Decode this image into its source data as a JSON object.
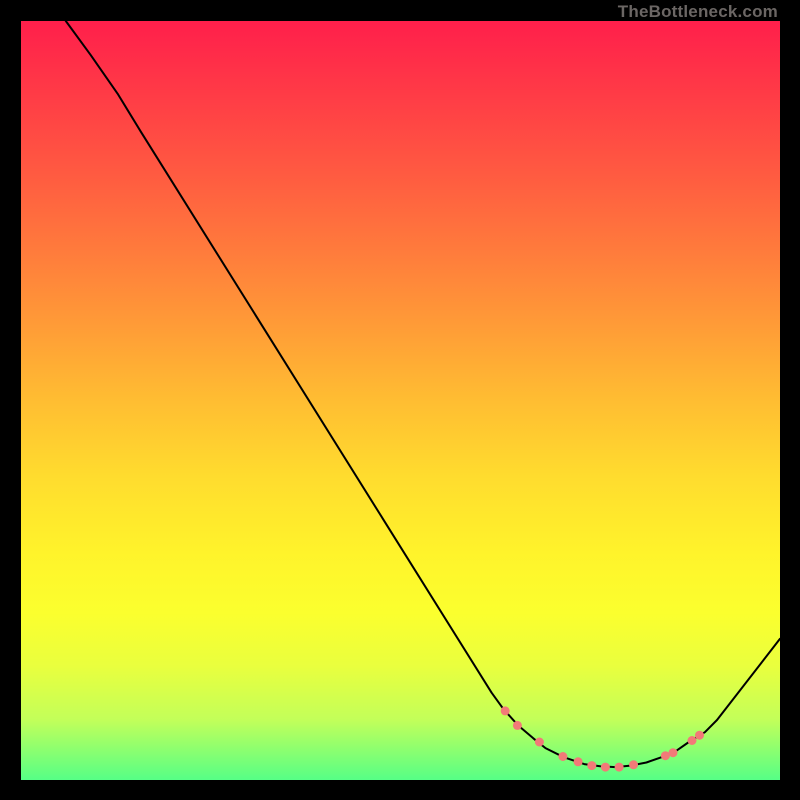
{
  "watermark": "TheBottleneck.com",
  "colors": {
    "background": "#000000",
    "curve_stroke": "#000000",
    "dot_fill": "#f27a78",
    "gradient_top": "#ff1f4b",
    "gradient_bottom": "#56ff86"
  },
  "chart_data": {
    "type": "line",
    "title": "",
    "xlabel": "",
    "ylabel": "",
    "xlim": [
      0,
      100
    ],
    "ylim": [
      0,
      100
    ],
    "curve": [
      {
        "x": 5.9,
        "y": 100.0
      },
      {
        "x": 9.2,
        "y": 95.5
      },
      {
        "x": 12.8,
        "y": 90.3
      },
      {
        "x": 15.8,
        "y": 85.4
      },
      {
        "x": 62.0,
        "y": 11.5
      },
      {
        "x": 63.6,
        "y": 9.3
      },
      {
        "x": 65.5,
        "y": 7.2
      },
      {
        "x": 67.5,
        "y": 5.5
      },
      {
        "x": 69.1,
        "y": 4.2
      },
      {
        "x": 71.5,
        "y": 3.0
      },
      {
        "x": 74.2,
        "y": 2.1
      },
      {
        "x": 76.3,
        "y": 1.8
      },
      {
        "x": 78.3,
        "y": 1.7
      },
      {
        "x": 80.3,
        "y": 1.9
      },
      {
        "x": 82.4,
        "y": 2.3
      },
      {
        "x": 84.4,
        "y": 3.0
      },
      {
        "x": 86.4,
        "y": 3.9
      },
      {
        "x": 88.0,
        "y": 5.0
      },
      {
        "x": 90.1,
        "y": 6.3
      },
      {
        "x": 91.7,
        "y": 7.9
      },
      {
        "x": 100.0,
        "y": 18.6
      }
    ],
    "dots": [
      {
        "x": 63.8,
        "y": 9.1
      },
      {
        "x": 65.4,
        "y": 7.2
      },
      {
        "x": 68.3,
        "y": 5.0
      },
      {
        "x": 71.4,
        "y": 3.1
      },
      {
        "x": 73.4,
        "y": 2.4
      },
      {
        "x": 75.2,
        "y": 1.9
      },
      {
        "x": 77.0,
        "y": 1.7
      },
      {
        "x": 78.8,
        "y": 1.7
      },
      {
        "x": 80.7,
        "y": 2.0
      },
      {
        "x": 84.9,
        "y": 3.2
      },
      {
        "x": 85.9,
        "y": 3.6
      },
      {
        "x": 88.4,
        "y": 5.2
      },
      {
        "x": 89.4,
        "y": 5.9
      }
    ],
    "dot_radius": 4.5
  }
}
